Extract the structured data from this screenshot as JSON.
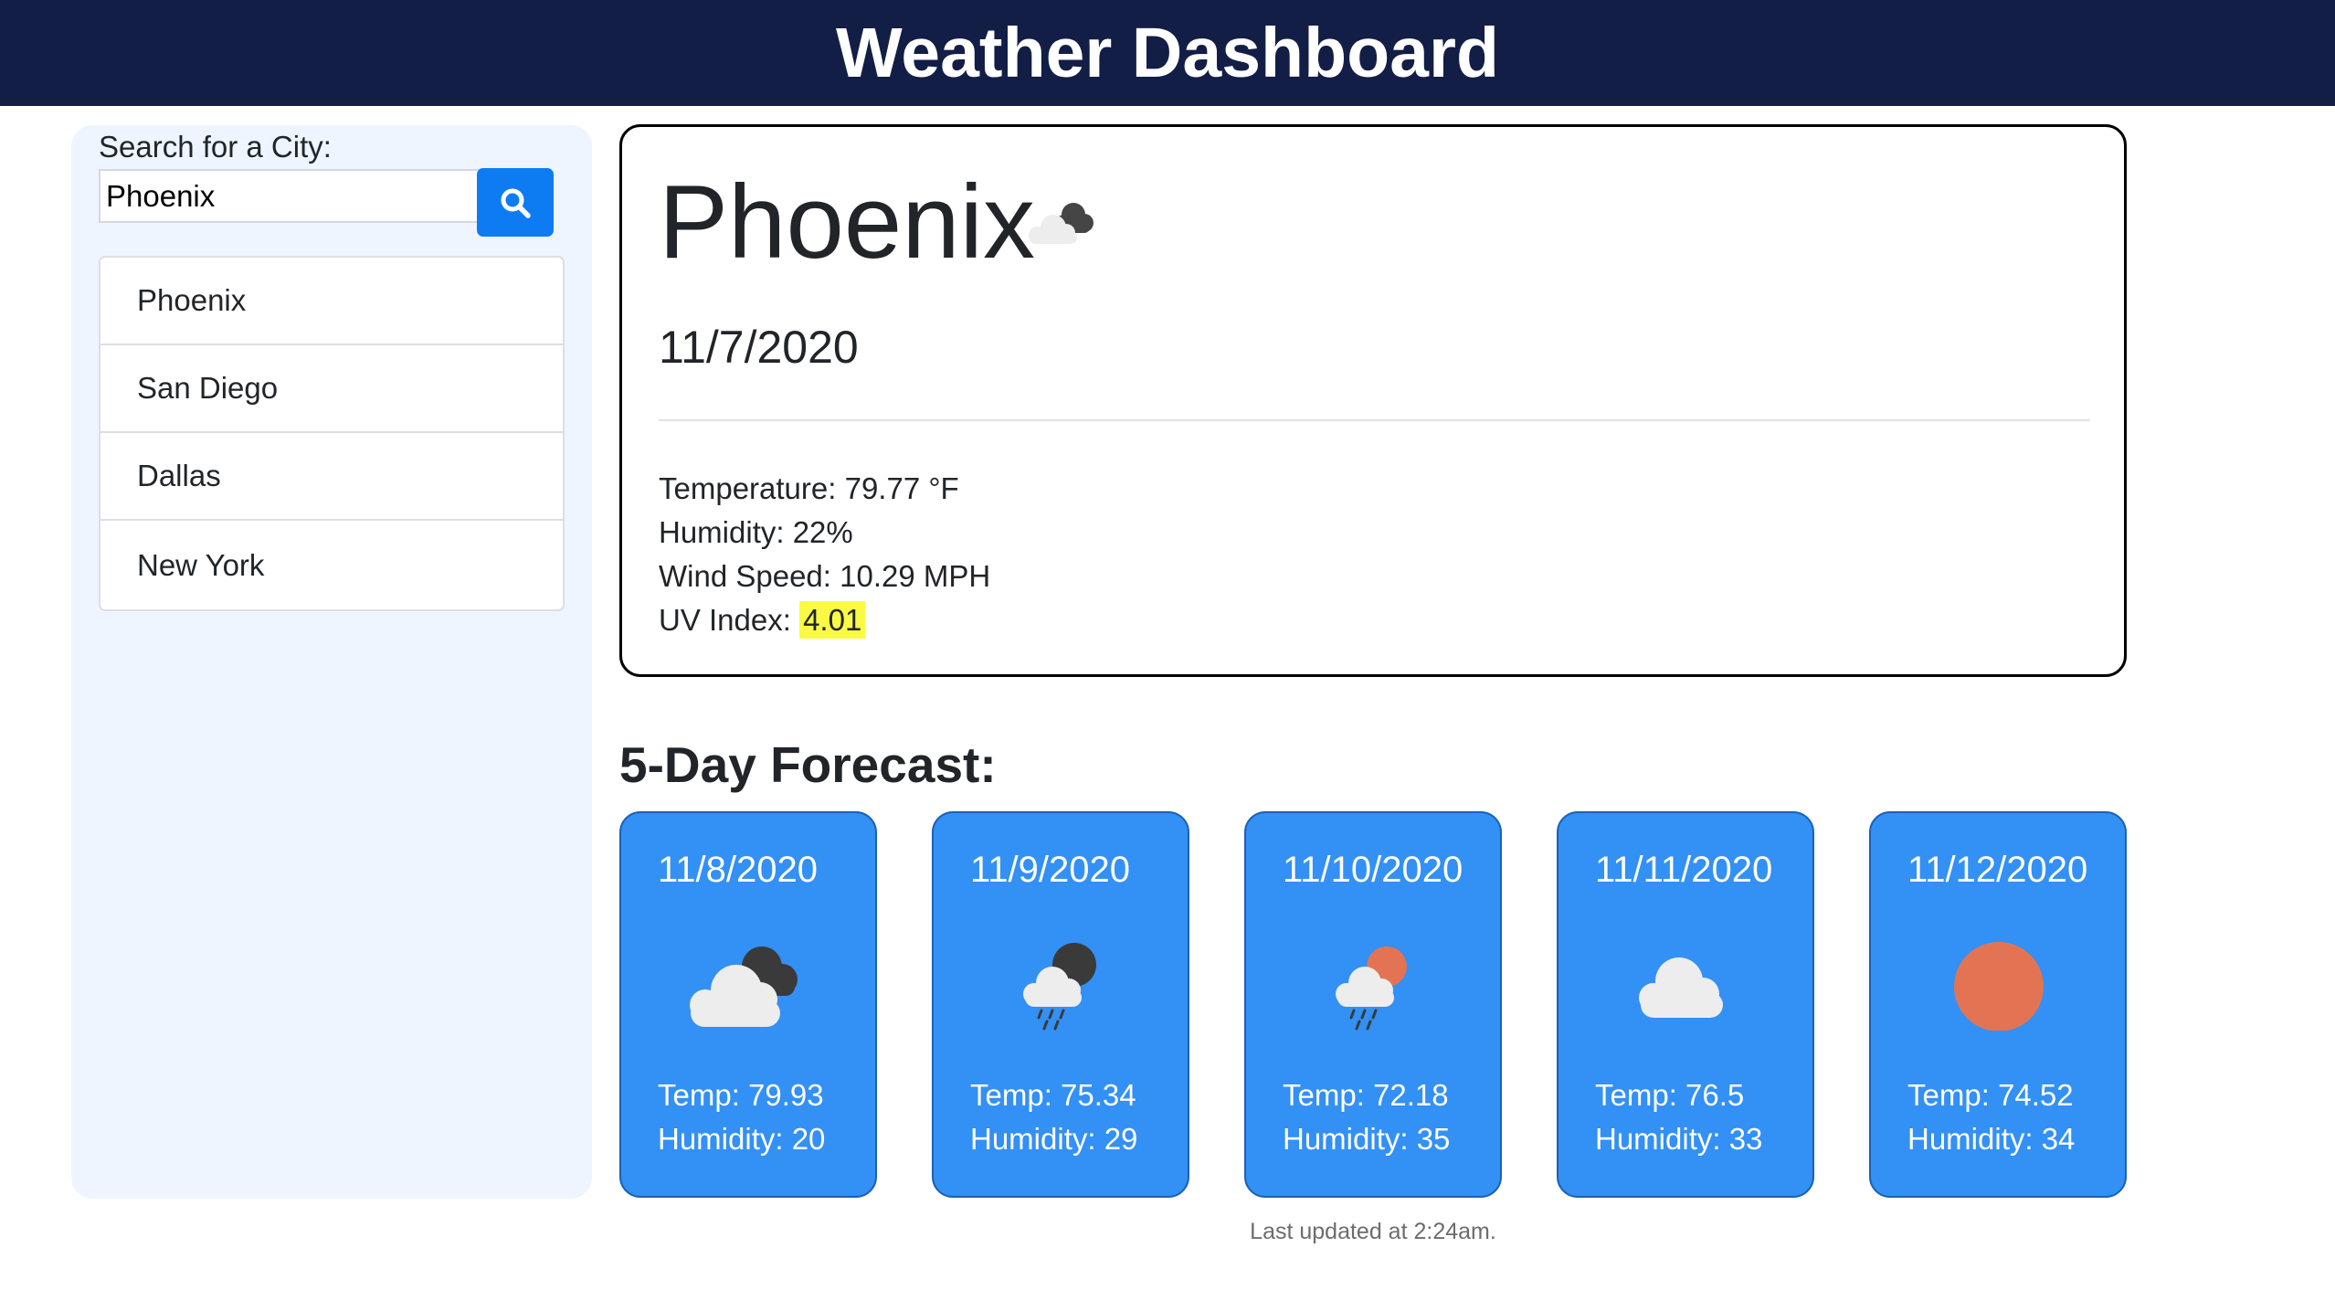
{
  "header": {
    "title": "Weather Dashboard"
  },
  "sidebar": {
    "search_label": "Search for a City:",
    "search_value": "Phoenix",
    "search_button_icon": "search-icon",
    "cities": [
      "Phoenix",
      "San Diego",
      "Dallas",
      "New York"
    ]
  },
  "current": {
    "city": "Phoenix",
    "icon": "cloudy-night-icon",
    "date": "11/7/2020",
    "temperature": "Temperature: 79.77 °F",
    "humidity": "Humidity: 22%",
    "wind": "Wind Speed: 10.29 MPH",
    "uv_label": "UV Index: ",
    "uv_value": "4.01"
  },
  "forecast": {
    "title": "5-Day Forecast:",
    "days": [
      {
        "date": "11/8/2020",
        "icon": "cloudy-night-icon",
        "temp": "Temp: 79.93",
        "humidity": "Humidity: 20"
      },
      {
        "date": "11/9/2020",
        "icon": "rain-night-icon",
        "temp": "Temp: 75.34",
        "humidity": "Humidity: 29"
      },
      {
        "date": "11/10/2020",
        "icon": "rain-sun-icon",
        "temp": "Temp: 72.18",
        "humidity": "Humidity: 35"
      },
      {
        "date": "11/11/2020",
        "icon": "cloud-icon",
        "temp": "Temp: 76.5",
        "humidity": "Humidity: 33"
      },
      {
        "date": "11/12/2020",
        "icon": "sun-icon",
        "temp": "Temp: 74.52",
        "humidity": "Humidity: 34"
      }
    ]
  },
  "footer": {
    "text": "Last updated at 2:24am."
  },
  "colors": {
    "header_bg": "#121e45",
    "sidebar_bg": "#eef5fe",
    "button_blue": "#0d7cf2",
    "card_blue": "#3390f5",
    "uv_highlight": "#fafa45",
    "sun": "#e27454"
  }
}
